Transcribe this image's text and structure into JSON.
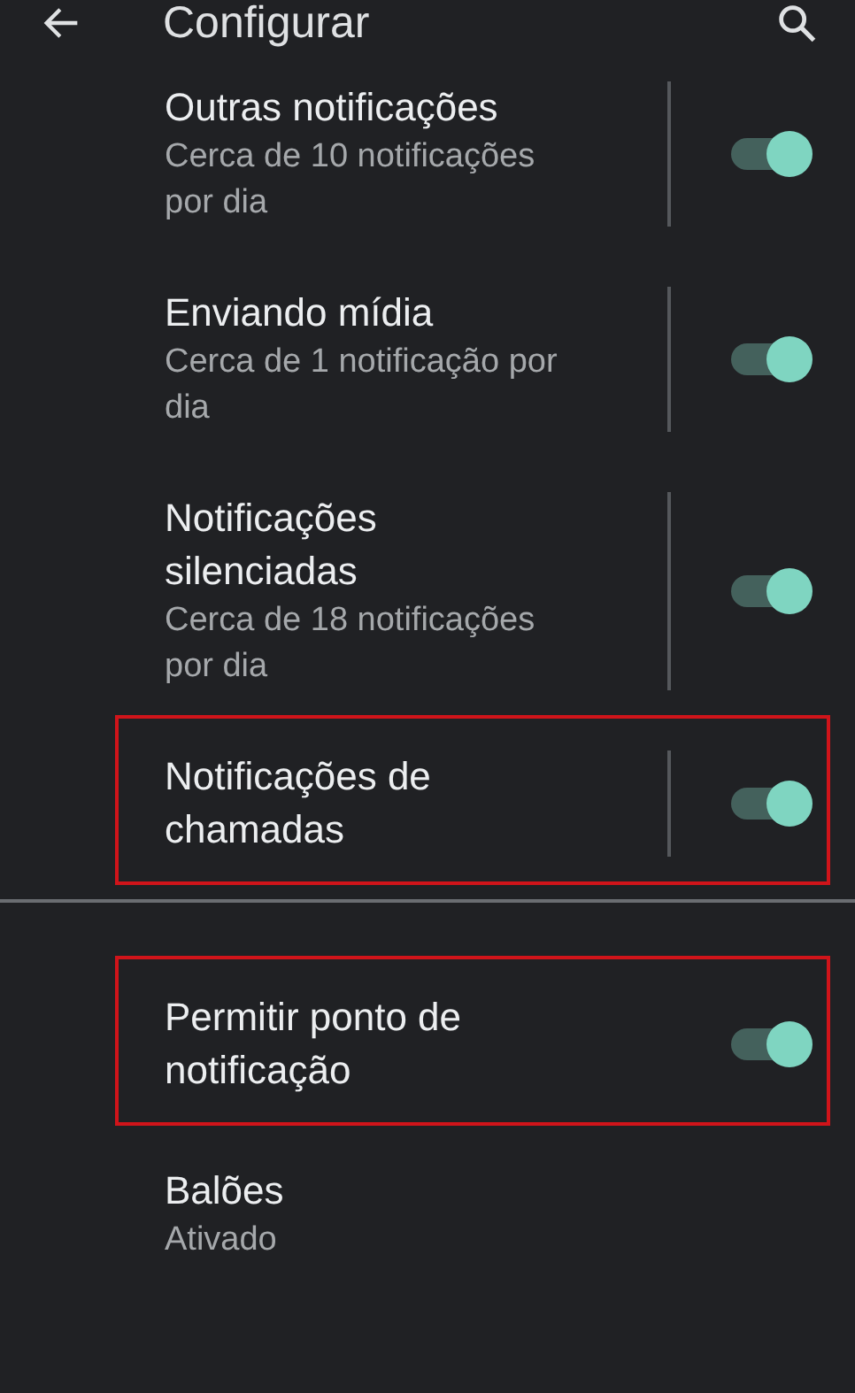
{
  "app_bar": {
    "title": "Configurar"
  },
  "sections": [
    {
      "items": [
        {
          "kind": "toggle",
          "title": "Outras notificações",
          "subtitle": "Cerca de 10 notificações por dia",
          "on": true,
          "highlighted": false
        },
        {
          "kind": "toggle",
          "title": "Enviando mídia",
          "subtitle": "Cerca de 1 notificação por dia",
          "on": true,
          "highlighted": false
        },
        {
          "kind": "toggle",
          "title": "Notificações silenciadas",
          "subtitle": "Cerca de 18 notificações por dia",
          "on": true,
          "highlighted": false
        },
        {
          "kind": "toggle",
          "title": "Notificações de chamadas",
          "on": true,
          "highlighted": true
        }
      ]
    },
    {
      "items": [
        {
          "kind": "switch",
          "title": "Permitir ponto de notificação",
          "on": true,
          "highlighted": true
        },
        {
          "kind": "text",
          "title": "Balões",
          "subtitle": "Ativado",
          "highlighted": false
        }
      ]
    }
  ]
}
